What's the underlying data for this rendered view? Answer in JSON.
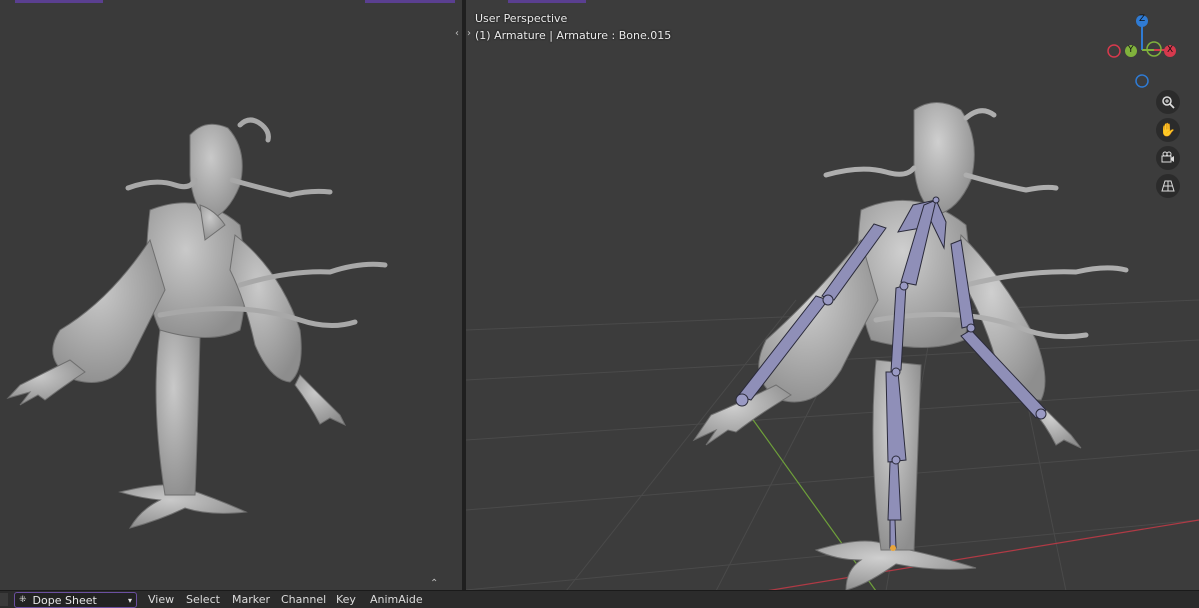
{
  "viewport_right": {
    "view_name": "User Perspective",
    "object_info": "(1) Armature | Armature : Bone.015"
  },
  "gizmo": {
    "x": "X",
    "y": "Y",
    "z": "Z"
  },
  "nav_icons": [
    "zoom-icon",
    "hand-pan-icon",
    "camera-view-icon",
    "grid-ortho-icon"
  ],
  "bottom_bar": {
    "editor_type": "Dope Sheet",
    "menus": [
      "View",
      "Select",
      "Marker",
      "Channel",
      "Key",
      "AnimAide"
    ]
  },
  "colors": {
    "bone": "#8f8fb8",
    "selected_outline": "#7a4fd0",
    "axis_x": "#d7394d",
    "axis_y": "#80b23c",
    "axis_z": "#2f7bd4"
  }
}
